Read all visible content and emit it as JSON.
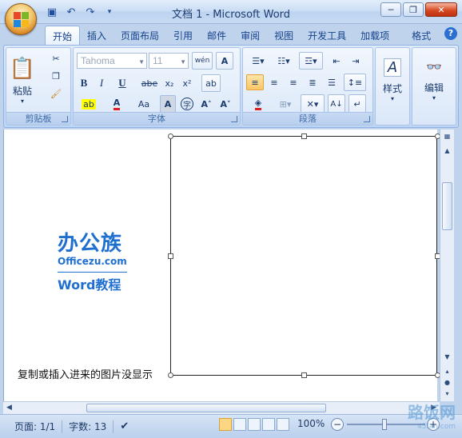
{
  "window": {
    "title": "文档 1 - Microsoft Word"
  },
  "tabs": [
    "开始",
    "插入",
    "页面布局",
    "引用",
    "邮件",
    "审阅",
    "视图",
    "开发工具",
    "加载项",
    "格式"
  ],
  "ribbon": {
    "clipboard": {
      "label": "剪贴板",
      "paste": "粘贴"
    },
    "font": {
      "label": "字体",
      "font_name": "Tahoma",
      "font_size": "11",
      "bold": "B",
      "italic": "I",
      "underline": "U",
      "strike": "abe",
      "sub": "x₂",
      "sup": "x²",
      "grow": "A",
      "shrink": "A",
      "caseBtn": "Aa",
      "charborder": "A",
      "wen": "wén"
    },
    "paragraph": {
      "label": "段落"
    },
    "styles": {
      "label": "样式"
    },
    "editing": {
      "label": "编辑"
    }
  },
  "document": {
    "logo_main": "办公族",
    "logo_url": "Officezu.com",
    "logo_sub": "Word教程",
    "caption": "复制或插入进来的图片没显示"
  },
  "status": {
    "page": "页面: 1/1",
    "words": "字数: 13",
    "zoom": "100%"
  },
  "watermark": "路饭网",
  "watermark_sub": "45fan.com",
  "colors": {
    "accent_blue": "#15428b",
    "logo_blue": "#1e6fd0"
  }
}
